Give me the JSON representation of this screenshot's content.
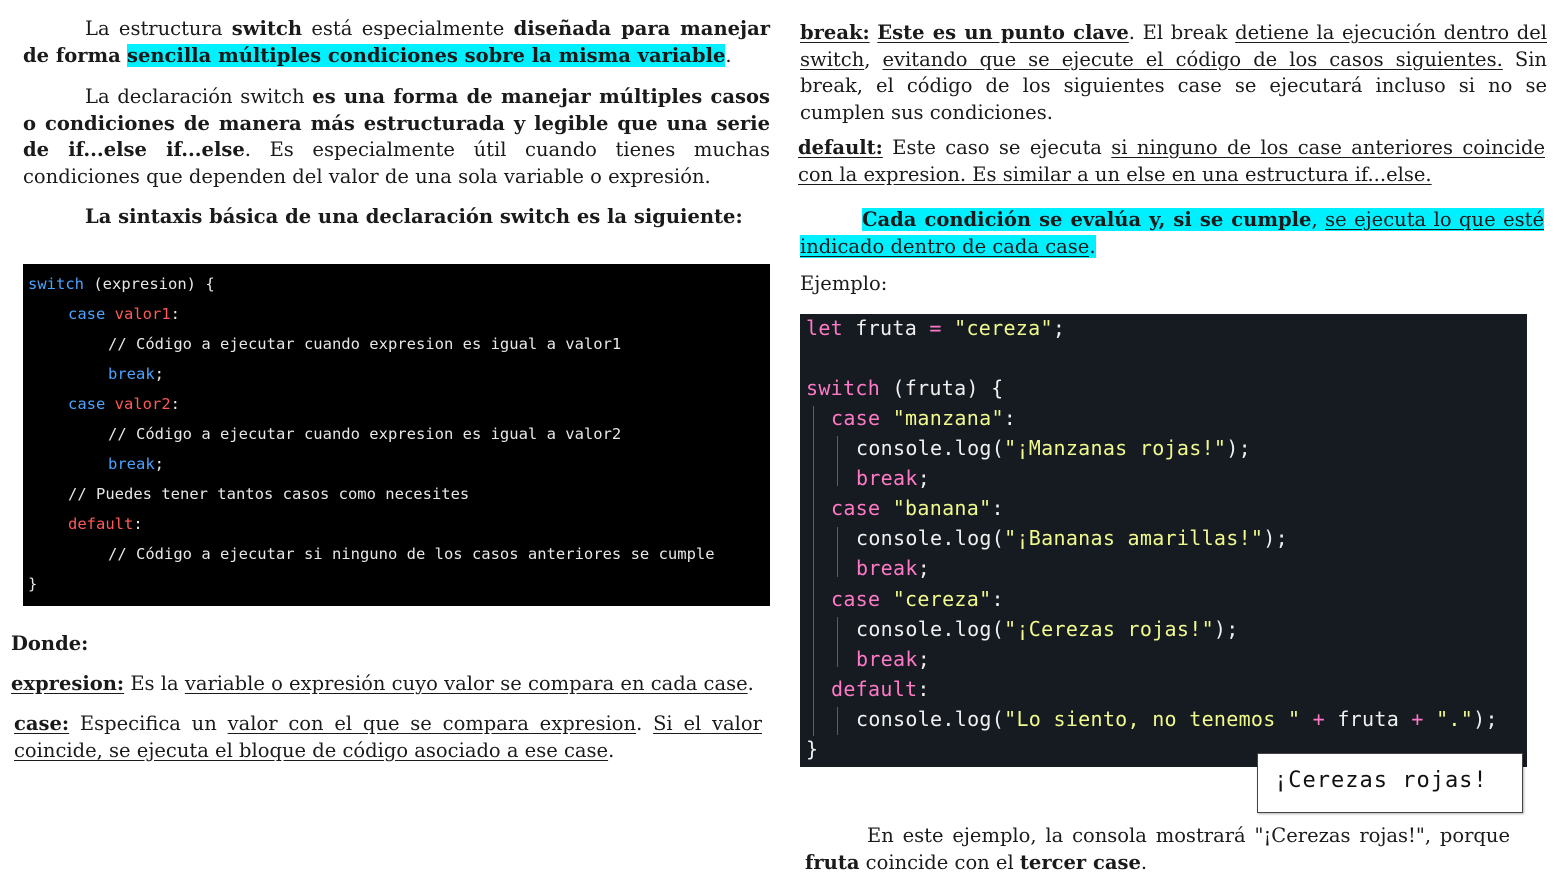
{
  "left": {
    "p1": {
      "t1": "La estructura ",
      "b1": "switch",
      "t2": " está especialmente ",
      "b2": "diseñada para manejar de forma",
      "t3": " ",
      "hl": "sencilla múltiples condiciones sobre la misma variable",
      "t4": "."
    },
    "p2": {
      "t1": "La declaración switch ",
      "b1": "es una forma de manejar múltiples casos o condiciones de manera más estructurada y legible que una serie de if...else if...else",
      "t2": ". Es especialmente útil cuando tienes muchas condiciones que dependen del valor de una sola variable o expresión."
    },
    "p3": "La sintaxis básica de una declaración switch es la siguiente:",
    "code": {
      "l1_kw": "switch",
      "l1_rest": " (expresion) {",
      "l2_kw": "case",
      "l2_val": "valor1",
      "l2_rest": ":",
      "l3": "// Código a ejecutar cuando expresion es igual a valor1",
      "l4_kw": "break",
      "l4_rest": ";",
      "l5_kw": "case",
      "l5_val": "valor2",
      "l5_rest": ":",
      "l6": "// Código a ejecutar cuando expresion es igual a valor2",
      "l7_kw": "break",
      "l7_rest": ";",
      "l8": "// Puedes tener tantos casos como necesites",
      "l9_val": "default",
      "l9_rest": ":",
      "l10": "// Código a ejecutar si ninguno de los casos anteriores se cumple",
      "l11": "}"
    },
    "donde": "Donde:",
    "expresion": {
      "term": "expresion:",
      "t1": " Es la ",
      "u1": "variable o expresión cuyo valor se compara en cada case",
      "t2": "."
    },
    "case": {
      "term": "case:",
      "t1": " Especifica un ",
      "u1": "valor con el que se compara expresion",
      "t2": ". ",
      "u2": "Si el valor coincide, se ejecuta el bloque de código asociado a ese case",
      "t3": "."
    }
  },
  "right": {
    "break_def": {
      "term": "break:",
      "t0": " ",
      "b1": "Este es un punto clave",
      "t1": ". El break ",
      "u1": "detiene la ejecución dentro del switch",
      "t2": ", ",
      "u2": "evitando que se ejecute el código de los casos siguientes.",
      "t3": " Sin break, el código de los siguientes case se ejecutará incluso si no se cumplen sus condiciones."
    },
    "default_def": {
      "term": "default:",
      "t1": " Este caso se ejecuta ",
      "u1": "si ninguno de los case anteriores coincide con la expresion. Es similar a un else en una estructura if...else."
    },
    "cada": {
      "b1": "Cada condición se evalúa y, si se cumple",
      "t1": ", ",
      "u1": "se ejecuta lo que esté indicado dentro de cada case",
      "t2": "."
    },
    "ejemplo": "Ejemplo:",
    "code": {
      "l1_kw": "let",
      "l1_id": " fruta ",
      "l1_op": "=",
      "l1_str": " \"cereza\"",
      "l1_end": ";",
      "l3_kw": "switch",
      "l3_rest": " (fruta) {",
      "l4_kw": "case",
      "l4_str": " \"manzana\"",
      "l4_end": ":",
      "l5_a": "console",
      "l5_b": ".log(",
      "l5_str": "\"¡Manzanas rojas!\"",
      "l5_end": ");",
      "l6_kw": "break",
      "l6_end": ";",
      "l7_kw": "case",
      "l7_str": " \"banana\"",
      "l7_end": ":",
      "l8_a": "console",
      "l8_b": ".log(",
      "l8_str": "\"¡Bananas amarillas!\"",
      "l8_end": ");",
      "l9_kw": "break",
      "l9_end": ";",
      "l10_kw": "case",
      "l10_str": " \"cereza\"",
      "l10_end": ":",
      "l11_a": "console",
      "l11_b": ".log(",
      "l11_str": "\"¡Cerezas rojas!\"",
      "l11_end": ");",
      "l12_kw": "break",
      "l12_end": ";",
      "l13_kw": "default",
      "l13_end": ":",
      "l14_a": "console",
      "l14_b": ".log(",
      "l14_str": "\"Lo siento, no tenemos \"",
      "l14_op": " + ",
      "l14_id": "fruta",
      "l14_op2": " + ",
      "l14_str2": "\".\"",
      "l14_end": ");",
      "l15": "}"
    },
    "output": "¡Cerezas rojas!",
    "conclusion": {
      "t1": "En este ejemplo, la consola mostrará \"¡Cerezas rojas!\", porque ",
      "b1": "fruta",
      "t2": " coincide con el ",
      "b2": "tercer case",
      "t3": "."
    }
  }
}
